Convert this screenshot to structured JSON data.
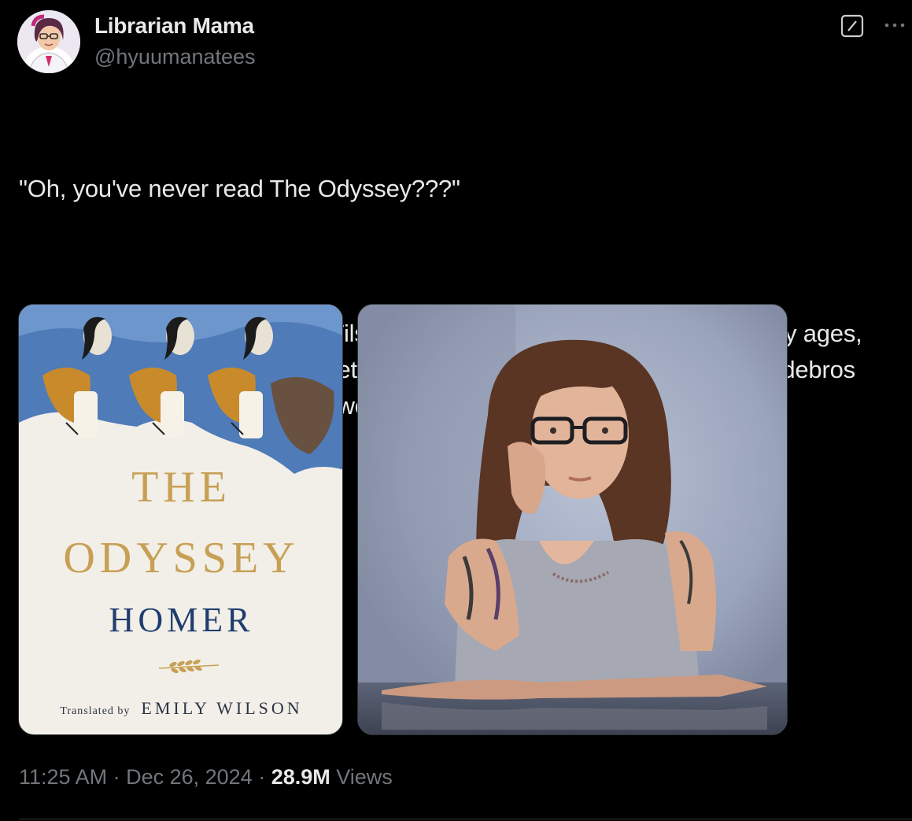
{
  "author": {
    "display_name": "Librarian Mama",
    "handle": "@hyuumanatees",
    "avatar_icon": "avatar-illustration"
  },
  "header_icons": {
    "grok": "grok-icon",
    "more": "more-icon"
  },
  "tweet": {
    "paragraph_1": "\"Oh, you've never read The Odyssey???\"",
    "paragraph_2": "Your timing is perfect. Emily Wilson's translation is the best one in literally ages, has that sweet iambic pentameter to give it a \"bouncy\" feel, & makes dudebros cry that the classic has \"gone woke\".",
    "emoji": "grinning-face-with-smiling-eyes"
  },
  "media": {
    "book_cover": {
      "title_line1": "THE",
      "title_line2": "ODYSSEY",
      "author": "HOMER",
      "translated_by": "Translated by",
      "translator": "EMILY WILSON"
    },
    "photo": {
      "subject": "woman-portrait"
    }
  },
  "meta": {
    "time": "11:25 AM",
    "separator1": " · ",
    "date": "Dec 26, 2024",
    "separator2": " · ",
    "views_count": "28.9M",
    "views_label": " Views"
  },
  "colors": {
    "background": "#000000",
    "text_primary": "#e7e9ea",
    "text_secondary": "#71767b",
    "border": "#2f3336",
    "cover_gold": "#c7a055",
    "cover_blue": "#1f3d6e"
  }
}
